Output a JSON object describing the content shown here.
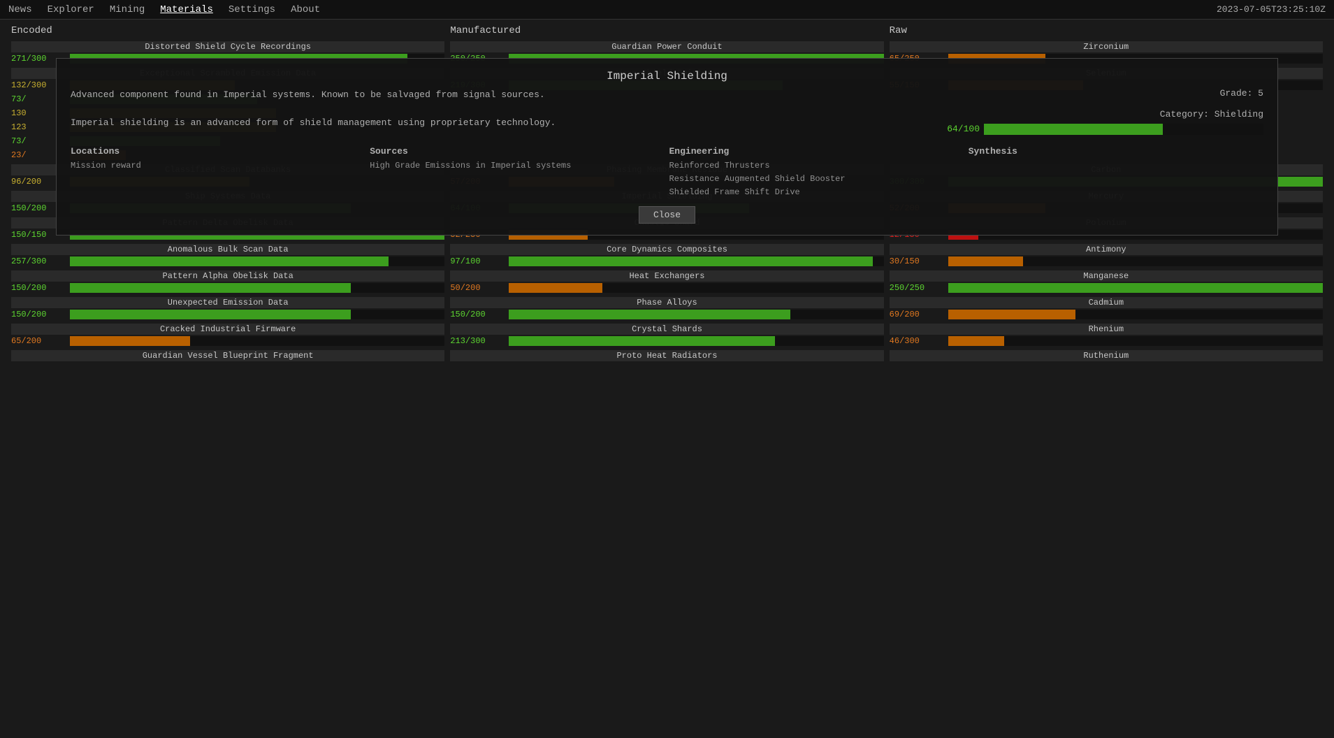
{
  "nav": {
    "items": [
      "News",
      "Explorer",
      "Mining",
      "Materials",
      "Settings",
      "About"
    ],
    "active": "Materials",
    "timestamp": "2023-07-05T23:25:10Z"
  },
  "sections": {
    "encoded": "Encoded",
    "manufactured": "Manufactured",
    "raw": "Raw"
  },
  "modal": {
    "title": "Imperial Shielding",
    "desc1": "Advanced component found in Imperial systems. Known to be salvaged from signal sources.",
    "grade": "Grade: 5",
    "category": "Category: Shielding",
    "desc2": "Imperial shielding is an advanced form of shield management using proprietary technology.",
    "bar_value": "64/100",
    "bar_pct": 64,
    "locations_label": "Locations",
    "locations_value": "Mission reward",
    "sources_label": "Sources",
    "sources_value": "High Grade Emissions in Imperial systems",
    "engineering_label": "Engineering",
    "engineering_values": [
      "Reinforced Thrusters",
      "Resistance Augmented Shield Booster",
      "Shielded Frame Shift Drive"
    ],
    "synthesis_label": "Synthesis",
    "synthesis_values": [],
    "close_label": "Close"
  },
  "encoded": [
    {
      "name": "Distorted Shield Cycle Recordings",
      "value": "271/300",
      "pct": 90,
      "color": "green",
      "label_color": "green"
    },
    {
      "name": "Exceptional Scrambled Emission Data",
      "value": "132/300",
      "pct": 44,
      "color": "yellow",
      "label_color": "yellow"
    },
    {
      "name": "",
      "value": "73/",
      "pct": 50,
      "color": "green",
      "label_color": "green"
    },
    {
      "name": "",
      "value": "130",
      "pct": 55,
      "color": "yellow",
      "label_color": "yellow"
    },
    {
      "name": "",
      "value": "123",
      "pct": 55,
      "color": "yellow",
      "label_color": "yellow"
    },
    {
      "name": "",
      "value": "73/",
      "pct": 40,
      "color": "green",
      "label_color": "green"
    },
    {
      "name": "",
      "value": "23/",
      "pct": 15,
      "color": "orange",
      "label_color": "orange"
    },
    {
      "name": "Classified Scan Databanks",
      "value": "96/200",
      "pct": 48,
      "color": "yellow",
      "label_color": "yellow"
    },
    {
      "name": "Ship Systems Data",
      "value": "150/200",
      "pct": 75,
      "color": "green",
      "label_color": "green"
    },
    {
      "name": "Pattern Delta Obelisk Data",
      "value": "150/150",
      "pct": 100,
      "color": "green",
      "label_color": "green"
    },
    {
      "name": "Anomalous Bulk Scan Data",
      "value": "257/300",
      "pct": 85,
      "color": "green",
      "label_color": "green"
    },
    {
      "name": "Pattern Alpha Obelisk Data",
      "value": "150/200",
      "pct": 75,
      "color": "green",
      "label_color": "green"
    },
    {
      "name": "Unexpected Emission Data",
      "value": "150/200",
      "pct": 75,
      "color": "green",
      "label_color": "green"
    },
    {
      "name": "Cracked Industrial Firmware",
      "value": "65/200",
      "pct": 32,
      "color": "orange",
      "label_color": "orange"
    },
    {
      "name": "Guardian Vessel Blueprint Fragment",
      "value": "",
      "pct": 0,
      "color": "green",
      "label_color": "green"
    }
  ],
  "manufactured": [
    {
      "name": "Guardian Power Conduit",
      "value": "250/250",
      "pct": 100,
      "color": "green",
      "label_color": "green"
    },
    {
      "name": "Worn Shield Emitters",
      "value": "219/300",
      "pct": 73,
      "color": "green",
      "label_color": "green"
    },
    {
      "name": "",
      "value": "",
      "pct": 0,
      "color": "green",
      "label_color": "green"
    },
    {
      "name": "",
      "value": "",
      "pct": 0,
      "color": "green",
      "label_color": "green"
    },
    {
      "name": "",
      "value": "",
      "pct": 0,
      "color": "green",
      "label_color": "green"
    },
    {
      "name": "",
      "value": "",
      "pct": 0,
      "color": "green",
      "label_color": "green"
    },
    {
      "name": "",
      "value": "",
      "pct": 0,
      "color": "green",
      "label_color": "green"
    },
    {
      "name": "Phasing Membrane Residue",
      "value": "57/200",
      "pct": 28,
      "color": "orange",
      "label_color": "orange"
    },
    {
      "name": "Imperial Shielding",
      "value": "64/100",
      "pct": 64,
      "color": "green",
      "label_color": "green"
    },
    {
      "name": "Caustic Shard",
      "value": "52/250",
      "pct": 21,
      "color": "orange",
      "label_color": "orange"
    },
    {
      "name": "Core Dynamics Composites",
      "value": "97/100",
      "pct": 97,
      "color": "green",
      "label_color": "green"
    },
    {
      "name": "Heat Exchangers",
      "value": "50/200",
      "pct": 25,
      "color": "orange",
      "label_color": "orange"
    },
    {
      "name": "Phase Alloys",
      "value": "150/200",
      "pct": 75,
      "color": "green",
      "label_color": "green"
    },
    {
      "name": "Crystal Shards",
      "value": "213/300",
      "pct": 71,
      "color": "green",
      "label_color": "green"
    },
    {
      "name": "Proto Heat Radiators",
      "value": "",
      "pct": 0,
      "color": "green",
      "label_color": "green"
    }
  ],
  "raw": [
    {
      "name": "Zirconium",
      "value": "65/250",
      "pct": 26,
      "color": "orange",
      "label_color": "orange"
    },
    {
      "name": "Selenium",
      "value": "55/150",
      "pct": 36,
      "color": "orange",
      "label_color": "orange"
    },
    {
      "name": "",
      "value": "",
      "pct": 0,
      "color": "green",
      "label_color": "green"
    },
    {
      "name": "",
      "value": "",
      "pct": 0,
      "color": "green",
      "label_color": "green"
    },
    {
      "name": "",
      "value": "",
      "pct": 0,
      "color": "green",
      "label_color": "green"
    },
    {
      "name": "",
      "value": "",
      "pct": 0,
      "color": "green",
      "label_color": "green"
    },
    {
      "name": "",
      "value": "",
      "pct": 0,
      "color": "green",
      "label_color": "green"
    },
    {
      "name": "Carbon",
      "value": "300/300",
      "pct": 100,
      "color": "green",
      "label_color": "green"
    },
    {
      "name": "Mercury",
      "value": "52/200",
      "pct": 26,
      "color": "orange",
      "label_color": "orange"
    },
    {
      "name": "Polonium",
      "value": "12/150",
      "pct": 8,
      "color": "red",
      "label_color": "red"
    },
    {
      "name": "Antimony",
      "value": "30/150",
      "pct": 20,
      "color": "orange",
      "label_color": "orange"
    },
    {
      "name": "Manganese",
      "value": "250/250",
      "pct": 100,
      "color": "green",
      "label_color": "green"
    },
    {
      "name": "Cadmium",
      "value": "69/200",
      "pct": 34,
      "color": "orange",
      "label_color": "orange"
    },
    {
      "name": "Rhenium",
      "value": "46/300",
      "pct": 15,
      "color": "orange",
      "label_color": "orange"
    },
    {
      "name": "Ruthenium",
      "value": "",
      "pct": 0,
      "color": "green",
      "label_color": "green"
    }
  ]
}
